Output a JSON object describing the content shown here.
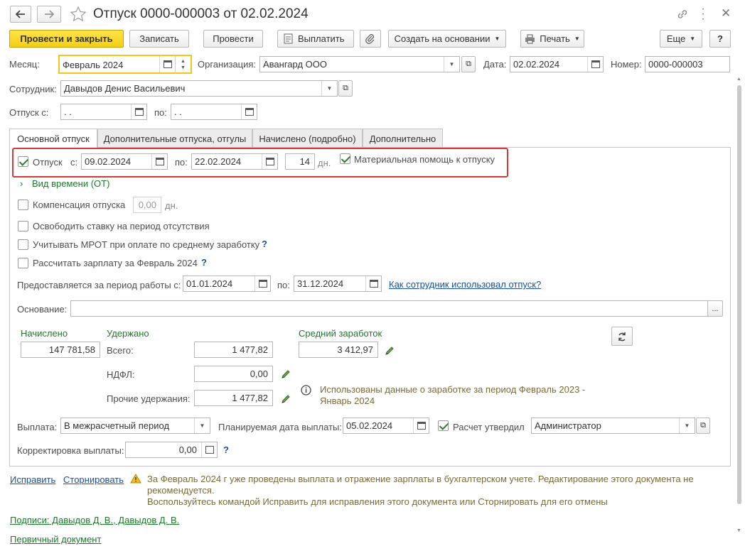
{
  "window": {
    "title": "Отпуск 0000-000003 от 02.02.2024"
  },
  "toolbar": {
    "post_close": "Провести и закрыть",
    "save": "Записать",
    "post": "Провести",
    "pay": "Выплатить",
    "create_based": "Создать на основании",
    "print": "Печать",
    "more": "Еще",
    "help": "?"
  },
  "header": {
    "month_label": "Месяц:",
    "month_value": "Февраль 2024",
    "org_label": "Организация:",
    "org_value": "Авангард ООО",
    "date_label": "Дата:",
    "date_value": "02.02.2024",
    "number_label": "Номер:",
    "number_value": "0000-000003",
    "employee_label": "Сотрудник:",
    "employee_value": "Давыдов Денис Васильевич",
    "vac_from_label": "Отпуск с:",
    "vac_from_value": " .  .",
    "vac_to_label": "по:",
    "vac_to_value": " .  ."
  },
  "tabs": [
    "Основной отпуск",
    "Дополнительные отпуска, отгулы",
    "Начислено (подробно)",
    "Дополнительно"
  ],
  "main": {
    "vacation_label": "Отпуск",
    "from_label": "с:",
    "from_value": "09.02.2024",
    "to_label": "по:",
    "to_value": "22.02.2024",
    "days_value": "14",
    "days_unit": "дн.",
    "aid_label": "Материальная помощь к отпуску",
    "time_type_label": "Вид времени (ОТ)",
    "compensation_label": "Компенсация отпуска",
    "compensation_value": "0,00",
    "compensation_unit": "дн.",
    "release_rate_label": "Освободить ставку на период отсутствия",
    "mrot_label": "Учитывать МРОТ при оплате по среднему заработку",
    "calc_salary_label": "Рассчитать зарплату за Февраль 2024",
    "help_mark": "?",
    "work_period_label": "Предоставляется за период работы с:",
    "work_from_value": "01.01.2024",
    "work_to_label": "по:",
    "work_to_value": "31.12.2024",
    "how_used_link": "Как сотрудник использовал отпуск?",
    "basis_label": "Основание:",
    "basis_value": "",
    "basis_btn": "...",
    "accrued_label": "Начислено",
    "accrued_value": "147 781,58",
    "withheld_label": "Удержано",
    "total_label": "Всего:",
    "total_value": "1 477,82",
    "ndfl_label": "НДФЛ:",
    "ndfl_value": "0,00",
    "other_label": "Прочие удержания:",
    "other_value": "1 477,82",
    "avg_label": "Средний заработок",
    "avg_value": "3 412,97",
    "info_text": "Использованы данные о заработке за период Февраль 2023 - Январь 2024",
    "payout_label": "Выплата:",
    "payout_value": "В межрасчетный период",
    "plan_date_label": "Планируемая дата выплаты:",
    "plan_date_value": "05.02.2024",
    "approved_label": "Расчет утвердил",
    "approved_value": "Администратор",
    "correction_label": "Корректировка выплаты:",
    "correction_value": "0,00"
  },
  "footer": {
    "fix_link": "Исправить",
    "storno_link": "Сторнировать",
    "warning_text": "За Февраль 2024 г уже проведены выплата и отражение зарплаты в бухгалтерском учете. Редактирование этого документа не рекомендуется.",
    "warning_text2": "Воспользуйтесь командой Исправить для исправления этого документа или Сторнировать для его отмены",
    "signatures_link": "Подписи: Давыдов Д. В., Давыдов Д. В.",
    "primary_doc_link": "Первичный документ"
  }
}
